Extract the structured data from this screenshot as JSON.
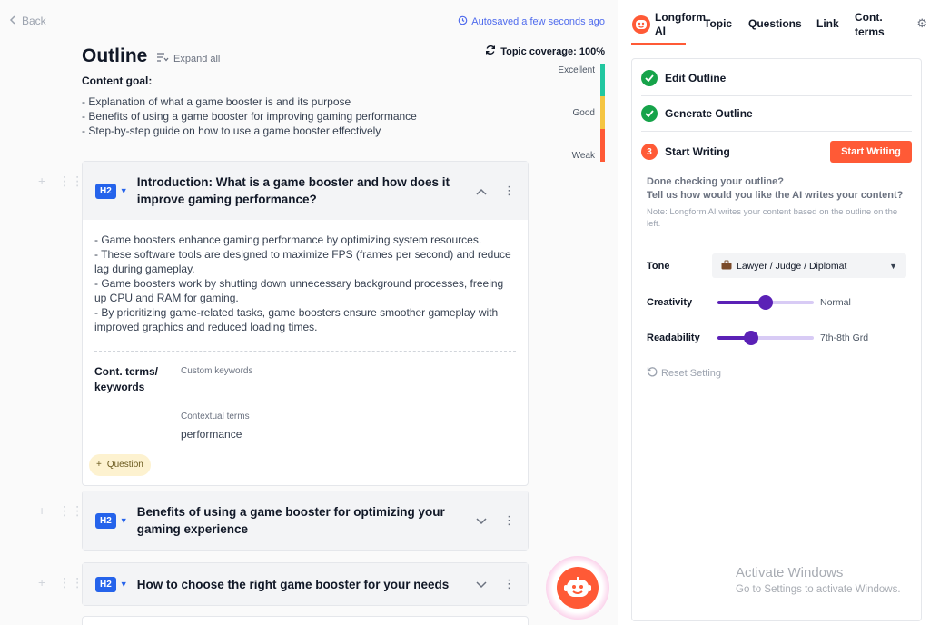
{
  "header": {
    "back_label": "Back",
    "autosave_text": "Autosaved a few seconds ago"
  },
  "outline": {
    "title": "Outline",
    "expand_all_label": "Expand all",
    "coverage_text": "Topic coverage: 100%",
    "content_goal_label": "Content goal:",
    "goals": [
      "- Explanation of what a game booster is and its purpose",
      "- Benefits of using a game booster for improving gaming performance",
      "- Step-by-step guide on how to use a game booster effectively"
    ]
  },
  "meter": {
    "labels": [
      "Excellent",
      "Good",
      "Weak"
    ],
    "colors": [
      "#22c7a0",
      "#f5c542",
      "#ff5a36"
    ]
  },
  "sections": [
    {
      "badge": "H2",
      "title": "Introduction: What is a game booster and how does it improve gaming performance?",
      "expanded": true,
      "body_lines": [
        "- Game boosters enhance gaming performance by optimizing system resources.",
        "- These software tools are designed to maximize FPS (frames per second) and reduce lag during gameplay.",
        "- Game boosters work by shutting down unnecessary background processes, freeing up CPU and RAM for gaming.",
        "- By prioritizing game-related tasks, game boosters ensure smoother gameplay with improved graphics and reduced loading times."
      ],
      "terms_label": "Cont. terms/ keywords",
      "custom_keywords_label": "Custom keywords",
      "contextual_terms_label": "Contextual terms",
      "contextual_terms_value": "performance",
      "question_label": "Question"
    },
    {
      "badge": "H2",
      "title": "Benefits of using a game booster for optimizing your gaming experience",
      "expanded": false
    },
    {
      "badge": "H2",
      "title": "How to choose the right game booster for your needs",
      "expanded": false
    }
  ],
  "panel": {
    "tabs": [
      "Longform AI",
      "Topic",
      "Questions",
      "Link",
      "Cont. terms"
    ],
    "active_tab": "Longform AI",
    "steps": [
      {
        "label": "Edit Outline",
        "state": "done"
      },
      {
        "label": "Generate Outline",
        "state": "done"
      },
      {
        "label": "Start Writing",
        "state": "current",
        "number": "3"
      }
    ],
    "start_button_label": "Start Writing",
    "done_checking_line1": "Done checking your outline?",
    "done_checking_line2": "Tell us how would you like the AI writes your content?",
    "note": "Note: Longform AI writes your content based on the outline on the left.",
    "tone_label": "Tone",
    "tone_value": "Lawyer / Judge / Diplomat",
    "creativity_label": "Creativity",
    "creativity_value": "Normal",
    "creativity_level": 0.5,
    "readability_label": "Readability",
    "readability_value": "7th-8th Grd",
    "readability_level": 0.35,
    "reset_label": "Reset Setting"
  },
  "windows_notice": {
    "title": "Activate Windows",
    "subtitle": "Go to Settings to activate Windows."
  },
  "colors": {
    "accent": "#ff5a36",
    "primary_blue": "#2563eb",
    "slider_purple": "#5b21b6",
    "success_green": "#16a34a"
  }
}
